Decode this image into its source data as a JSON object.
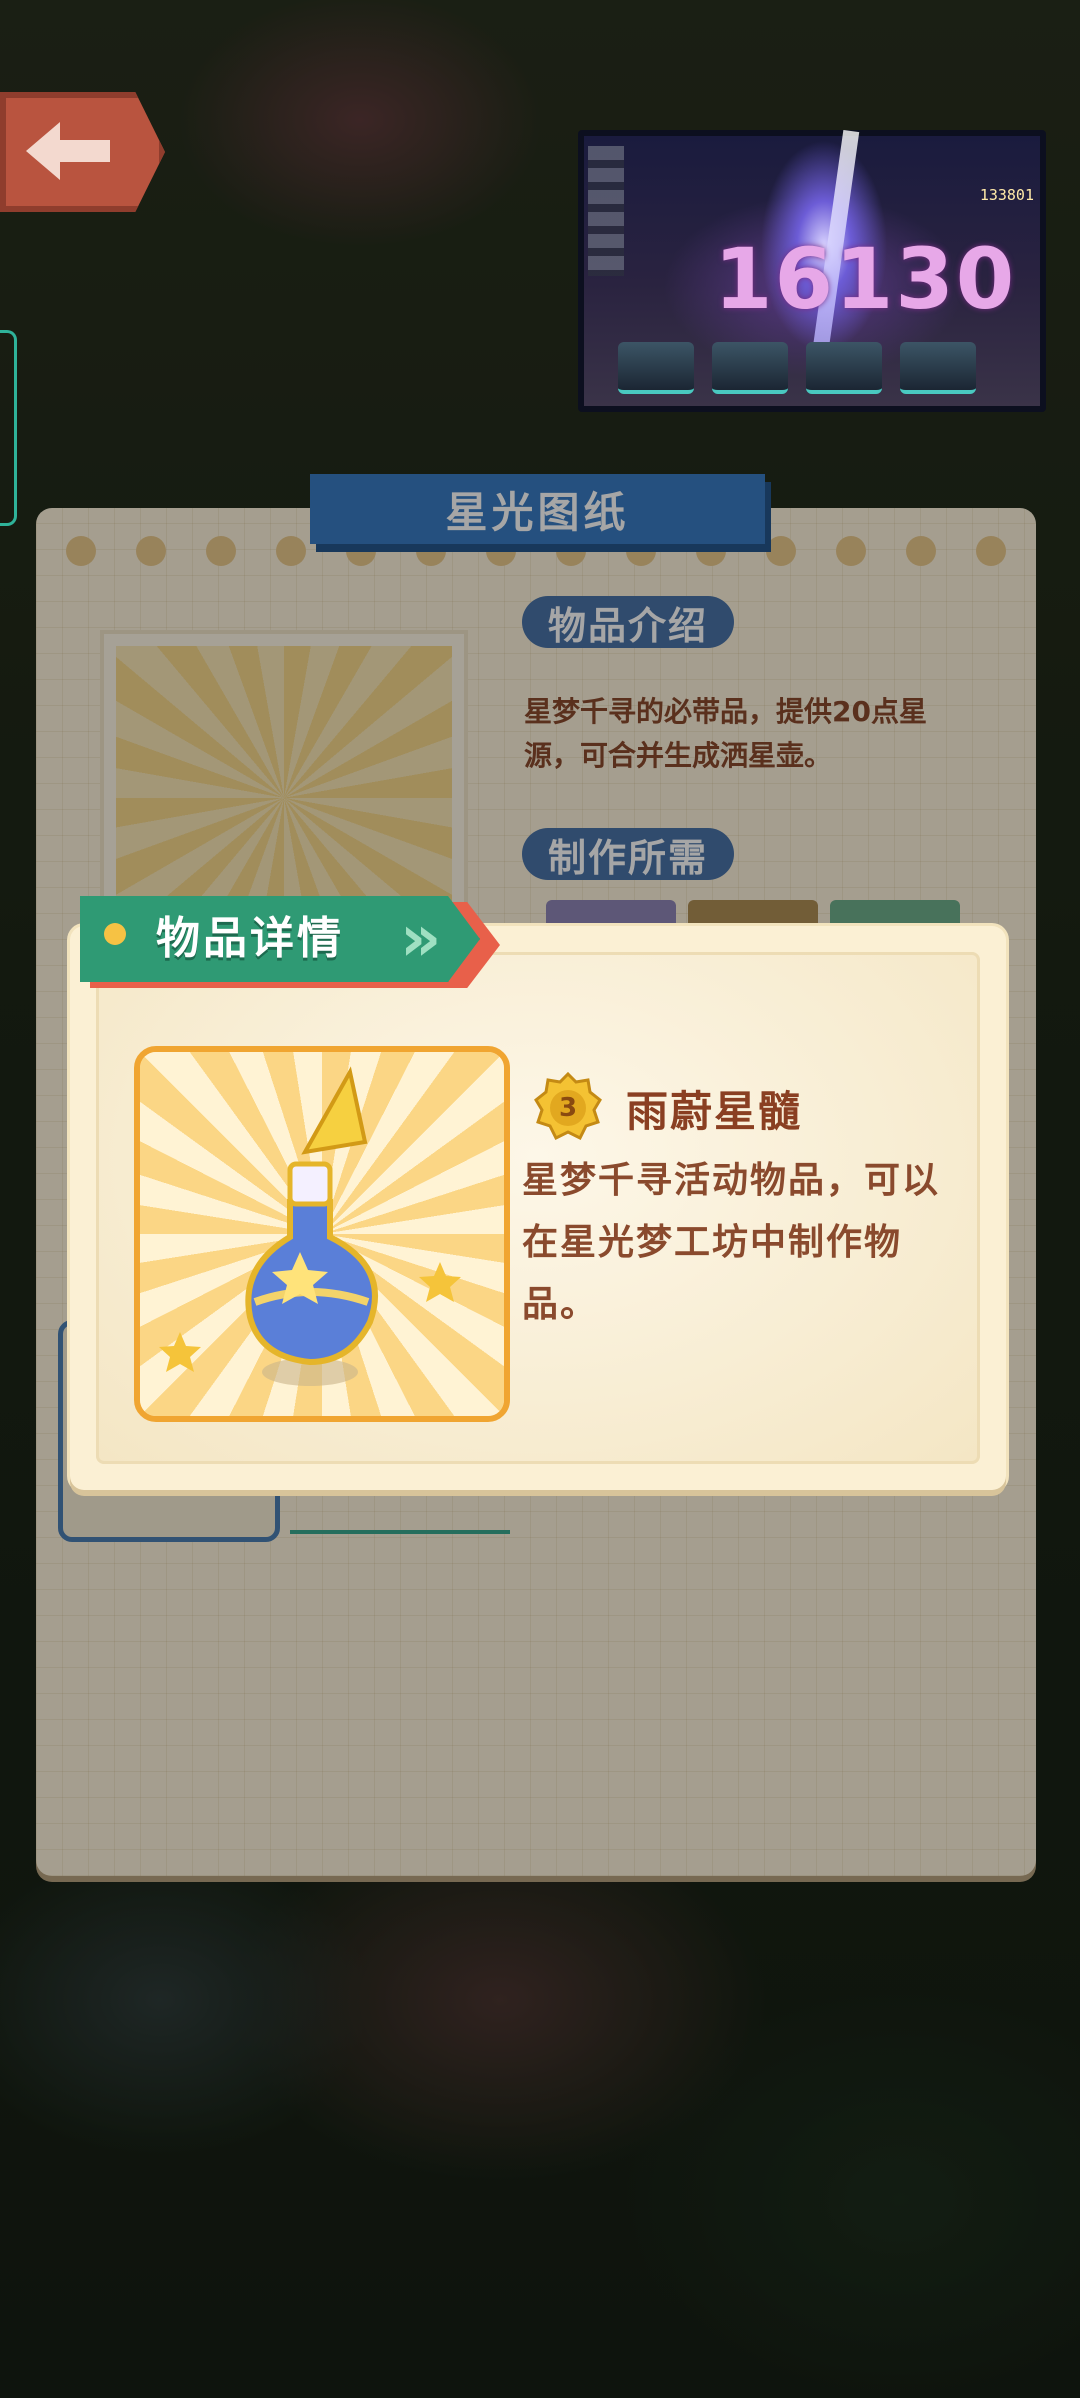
{
  "blueprint_panel": {
    "title": "星光图纸",
    "intro_heading": "物品介绍",
    "intro_text": "星梦千寻的必带品，提供20点星源，可合并生成洒星壶。",
    "materials_heading": "制作所需"
  },
  "video": {
    "damage_number": "16130",
    "counter": "133801"
  },
  "item_detail": {
    "header": "物品详情",
    "rarity_level": "3",
    "item_name": "雨蔚星髓",
    "description": "星梦千寻活动物品，可以在星光梦工坊中制作物品。"
  },
  "icons": {
    "back": "back-arrow-icon",
    "item_image": "star-potion-bottle-icon",
    "watering_can": "watering-can-icon",
    "rarity_badge": "rarity-medal-icon"
  },
  "colors": {
    "ribbon_green": "#2f9a74",
    "ribbon_red": "#e8604a",
    "title_blue": "#3a7cc3",
    "text_brown": "#8a4a2d",
    "icon_border": "#f0a531",
    "back_button": "#b9543f"
  }
}
